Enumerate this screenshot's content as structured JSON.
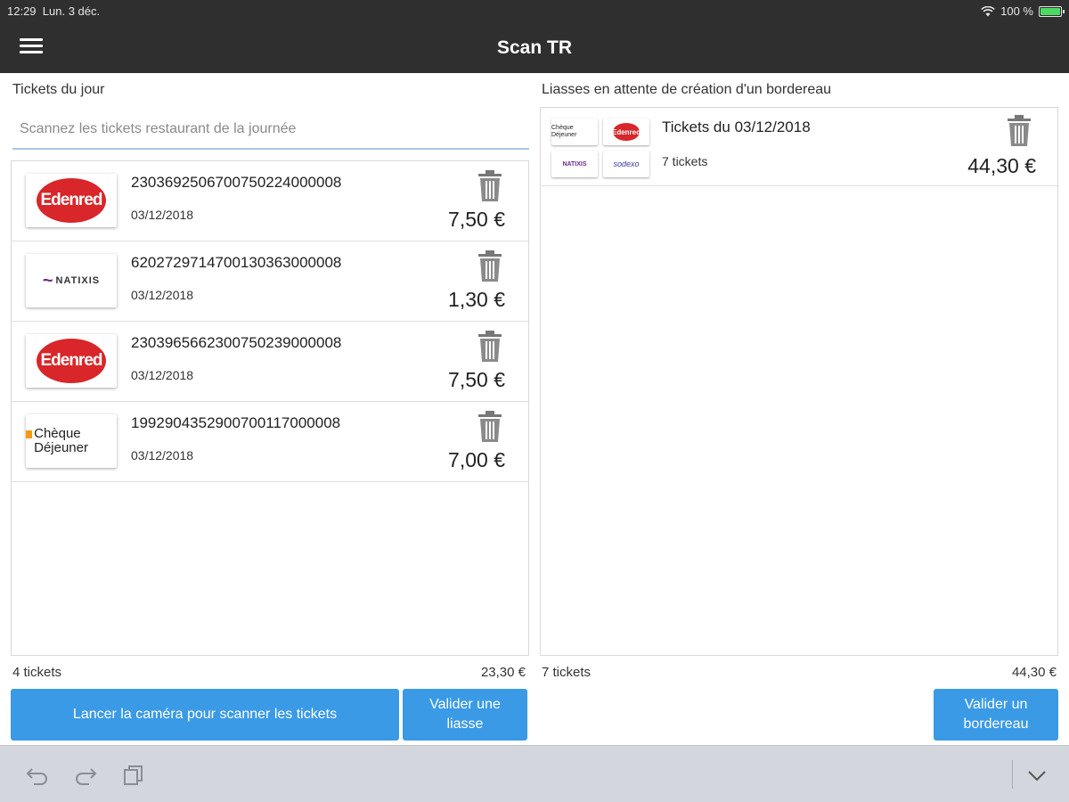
{
  "status_bar": {
    "time": "12:29",
    "date": "Lun. 3 déc.",
    "battery": "100 %"
  },
  "nav": {
    "title": "Scan TR"
  },
  "left": {
    "section_title": "Tickets du jour",
    "scan_placeholder": "Scannez les tickets restaurant de la journée",
    "tickets": [
      {
        "code": "2303692506700750224000008",
        "date": "03/12/2018",
        "amount": "7,50 €",
        "issuer": "Edenred",
        "logo_text": "Edenred"
      },
      {
        "code": "6202729714700130363000008",
        "date": "03/12/2018",
        "amount": "1,30 €",
        "issuer": "Natixis",
        "logo_text": "NATIXIS"
      },
      {
        "code": "2303965662300750239000008",
        "date": "03/12/2018",
        "amount": "7,50 €",
        "issuer": "Edenred",
        "logo_text": "Edenred"
      },
      {
        "code": "1992904352900700117000008",
        "date": "03/12/2018",
        "amount": "7,00 €",
        "issuer": "Chèque Déjeuner",
        "logo_text": "Chèque Déjeuner"
      }
    ],
    "footer_count": "4 tickets",
    "footer_total": "23,30 €",
    "camera_button": "Lancer la caméra pour scanner les tickets",
    "validate_liasse_button": "Valider une liasse"
  },
  "right": {
    "section_title": "Liasses en attente de création d'un bordereau",
    "liasses": [
      {
        "title": "Tickets du 03/12/2018",
        "count": "7 tickets",
        "amount": "44,30 €",
        "mini_logos": [
          "Chèque Déjeuner",
          "Edenred",
          "NATIXIS",
          "sodexo"
        ]
      }
    ],
    "footer_count": "7 tickets",
    "footer_total": "44,30 €",
    "validate_bordereau_button": "Valider un bordereau"
  },
  "icons": {
    "menu": "hamburger-menu-icon",
    "trash": "trash-icon",
    "undo": "undo-icon",
    "redo": "redo-icon",
    "paste": "paste-icon",
    "dismiss": "chevron-down-icon",
    "wifi": "wifi-icon",
    "battery": "battery-icon"
  },
  "colors": {
    "nav_bg": "#2f2f2f",
    "button": "#3a9ae6",
    "edenred": "#d8262a",
    "natixis": "#6a2a8a",
    "cheque_dejeuner": "#f39c12",
    "input_underline": "#a8c8e2",
    "battery": "#4cd964"
  }
}
